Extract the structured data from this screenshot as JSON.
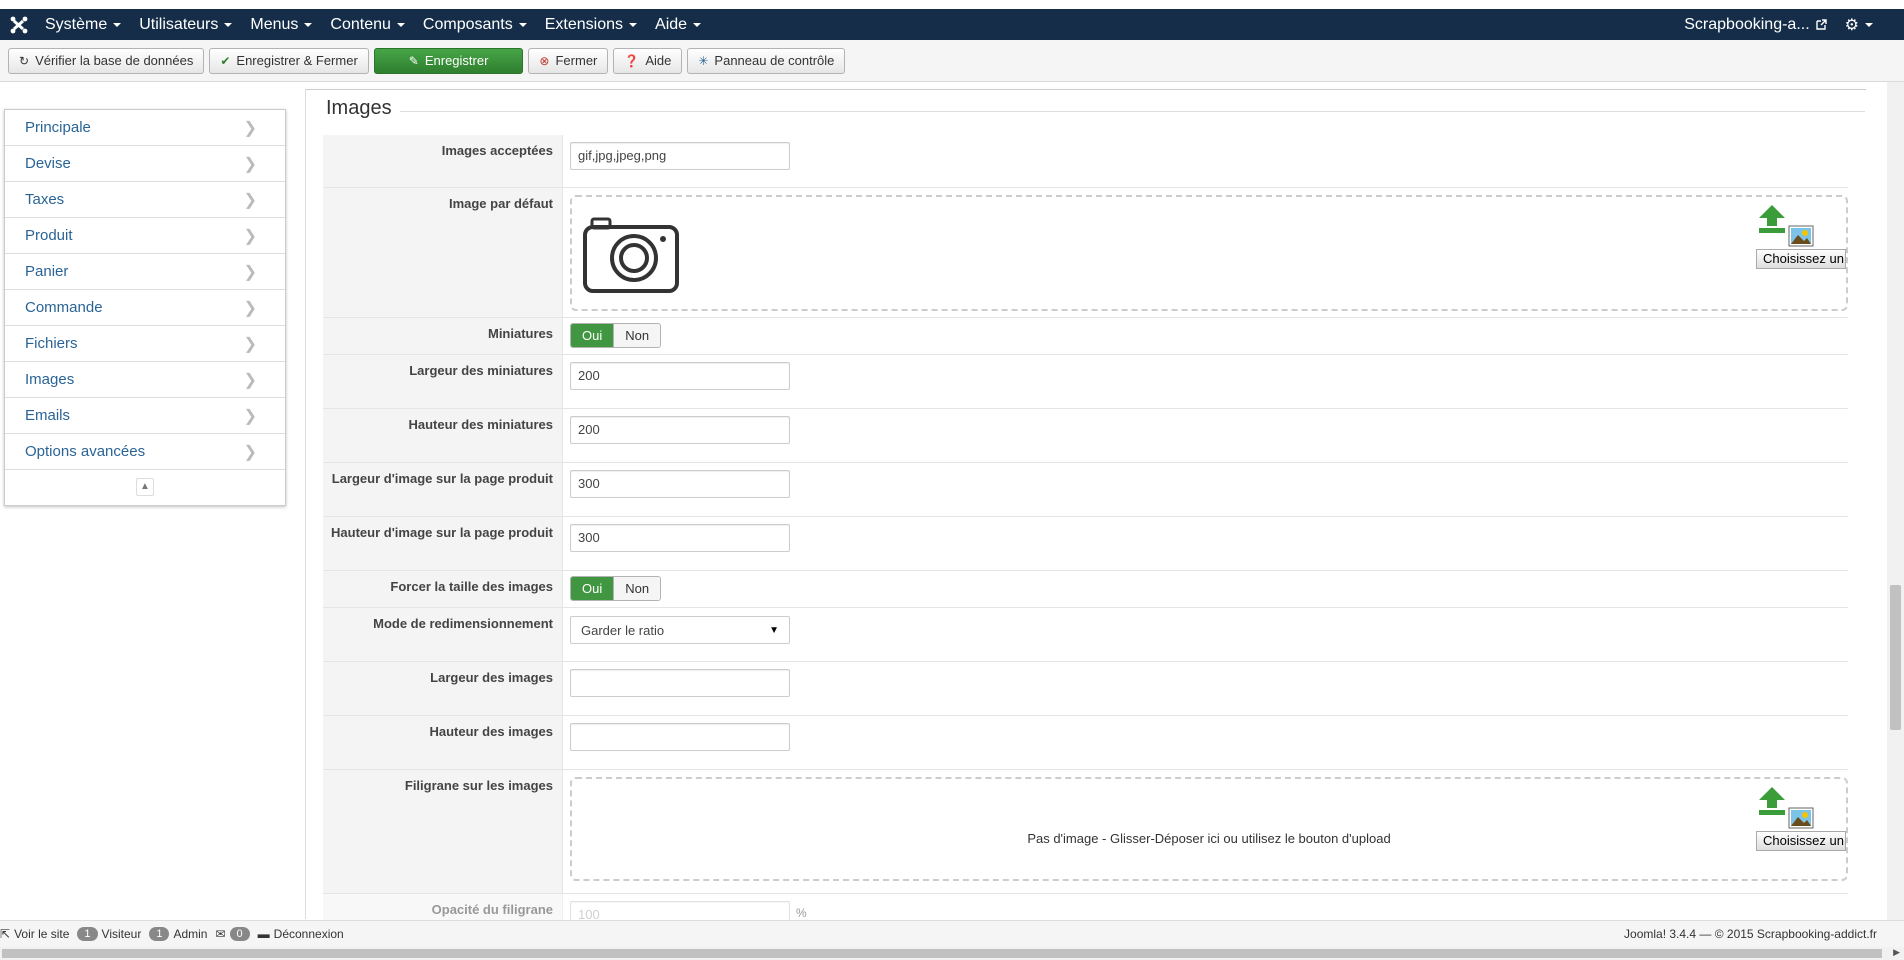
{
  "navbar": {
    "menus": [
      {
        "label": "Système"
      },
      {
        "label": "Utilisateurs"
      },
      {
        "label": "Menus"
      },
      {
        "label": "Contenu"
      },
      {
        "label": "Composants"
      },
      {
        "label": "Extensions"
      },
      {
        "label": "Aide"
      }
    ],
    "site_link": "Scrapbooking-a...",
    "colors": {
      "bar": "#152d48"
    }
  },
  "toolbar": {
    "check_db": "Vérifier la base de données",
    "save_close": "Enregistrer & Fermer",
    "save": "Enregistrer",
    "close": "Fermer",
    "help": "Aide",
    "control_panel": "Panneau de contrôle"
  },
  "sidebar": {
    "items": [
      {
        "label": "Principale"
      },
      {
        "label": "Devise"
      },
      {
        "label": "Taxes"
      },
      {
        "label": "Produit"
      },
      {
        "label": "Panier"
      },
      {
        "label": "Commande"
      },
      {
        "label": "Fichiers"
      },
      {
        "label": "Images"
      },
      {
        "label": "Emails"
      },
      {
        "label": "Options avancées"
      }
    ]
  },
  "section": {
    "title": "Images"
  },
  "form": {
    "accepted": {
      "label": "Images acceptées",
      "value": "gif,jpg,jpeg,png"
    },
    "default_image": {
      "label": "Image par défaut",
      "choose": "Choisissez un fichier"
    },
    "thumbnails": {
      "label": "Miniatures",
      "yes": "Oui",
      "no": "Non",
      "selected": "Oui"
    },
    "thumb_width": {
      "label": "Largeur des miniatures",
      "value": "200"
    },
    "thumb_height": {
      "label": "Hauteur des miniatures",
      "value": "200"
    },
    "product_width": {
      "label": "Largeur d'image sur la page produit",
      "value": "300"
    },
    "product_height": {
      "label": "Hauteur d'image sur la page produit",
      "value": "300"
    },
    "force_size": {
      "label": "Forcer la taille des images",
      "yes": "Oui",
      "no": "Non",
      "selected": "Oui"
    },
    "resize_mode": {
      "label": "Mode de redimensionnement",
      "value": "Garder le ratio"
    },
    "image_width": {
      "label": "Largeur des images",
      "value": ""
    },
    "image_height": {
      "label": "Hauteur des images",
      "value": ""
    },
    "watermark": {
      "label": "Filigrane sur les images",
      "empty_text": "Pas d'image - Glisser-Déposer ici ou utilisez le bouton d'upload",
      "choose": "Choisissez un fichier"
    },
    "watermark_opacity": {
      "label": "Opacité du filigrane",
      "placeholder": "100",
      "unit": "%"
    }
  },
  "footer": {
    "view_site": "Voir le site",
    "visitors_count": "1",
    "visitors_label": "Visiteur",
    "admins_count": "1",
    "admins_label": "Admin",
    "messages_count": "0",
    "logout": "Déconnexion",
    "copyright": "Joomla! 3.4.4  —  © 2015 Scrapbooking-addict.fr"
  }
}
